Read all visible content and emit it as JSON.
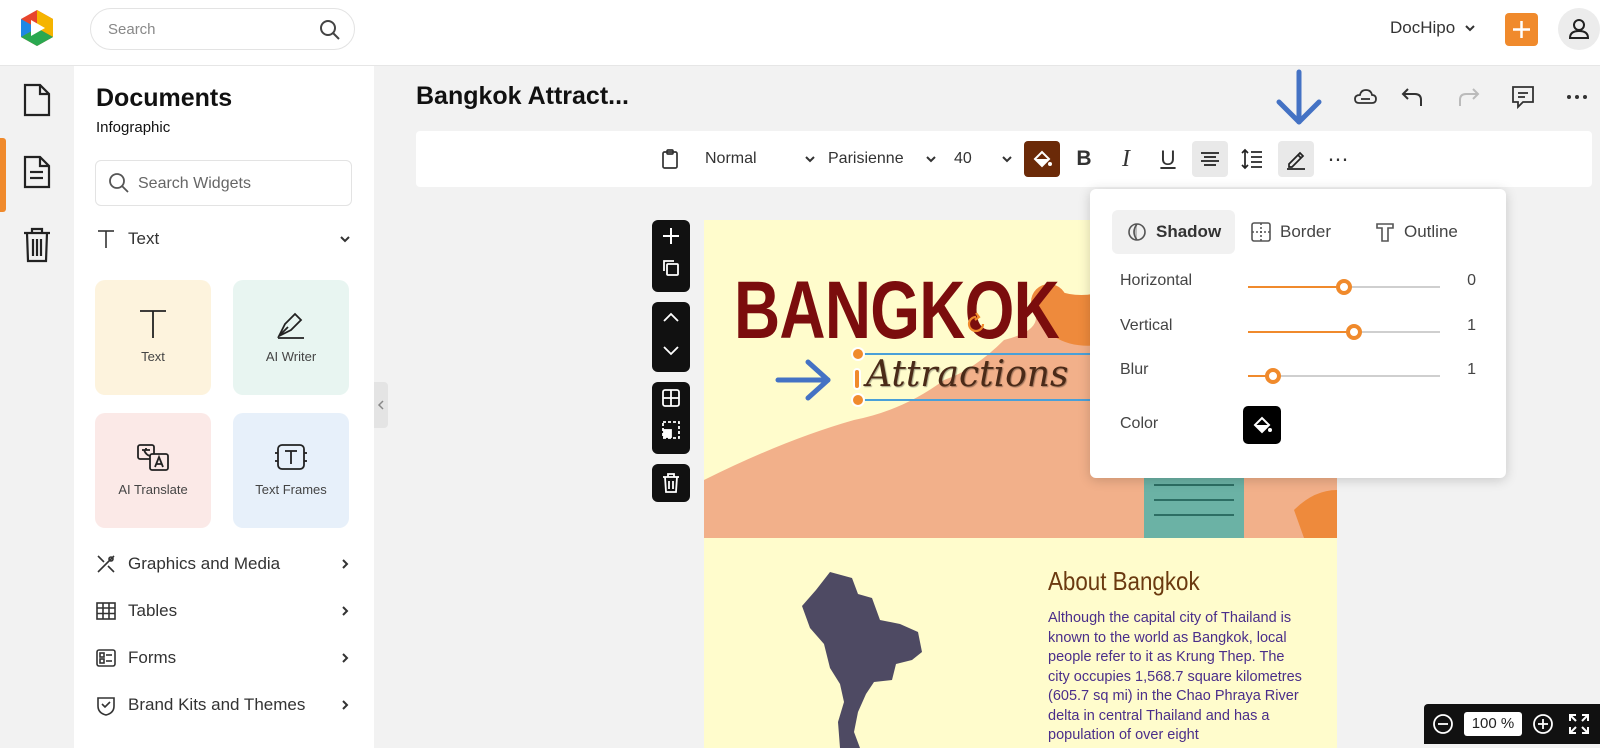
{
  "header": {
    "search_placeholder": "Search",
    "account_name": "DocHipo"
  },
  "widgets_panel": {
    "title": "Documents",
    "subtitle": "Infographic",
    "search_placeholder": "Search Widgets",
    "text_section": "Text",
    "tiles": [
      {
        "label": "Text",
        "icon": "text-icon"
      },
      {
        "label": "AI Writer",
        "icon": "pen-nib-icon"
      },
      {
        "label": "AI Translate",
        "icon": "translate-icon"
      },
      {
        "label": "Text Frames",
        "icon": "text-frame-icon"
      }
    ],
    "sections": [
      {
        "label": "Graphics and Media",
        "icon": "graphics-icon"
      },
      {
        "label": "Tables",
        "icon": "table-icon"
      },
      {
        "label": "Forms",
        "icon": "form-icon"
      },
      {
        "label": "Brand Kits and Themes",
        "icon": "brand-kit-icon"
      }
    ]
  },
  "editor": {
    "document_title": "Bangkok Attract...",
    "toolbar": {
      "style": "Normal",
      "font": "Parisienne",
      "size": "40",
      "bold": "B",
      "italic": "I",
      "underline": "U",
      "more": "⋯"
    }
  },
  "canvas": {
    "heading": "BANGKOK",
    "subheading": "Attractions",
    "about_title": "About Bangkok",
    "about_text": "Although the capital city of Thailand is known to the world as Bangkok, local people refer to it as Krung Thep. The city occupies 1,568.7 square kilometres (605.7 sq mi) in the Chao Phraya River delta in central Thailand and has a population of over eight"
  },
  "effects_popup": {
    "tabs": [
      "Shadow",
      "Border",
      "Outline"
    ],
    "active_tab": "Shadow",
    "rows": [
      {
        "label": "Horizontal",
        "value": "0",
        "level": 0.5
      },
      {
        "label": "Vertical",
        "value": "1",
        "level": 0.55
      },
      {
        "label": "Blur",
        "value": "1",
        "level": 0.13
      }
    ],
    "color_label": "Color"
  },
  "zoom": {
    "value": "100 %"
  },
  "colors": {
    "accent": "#f08a2c",
    "fill_button": "#6b2a08",
    "annotation_arrow": "#4472c4",
    "heading": "#7b0d0d"
  }
}
